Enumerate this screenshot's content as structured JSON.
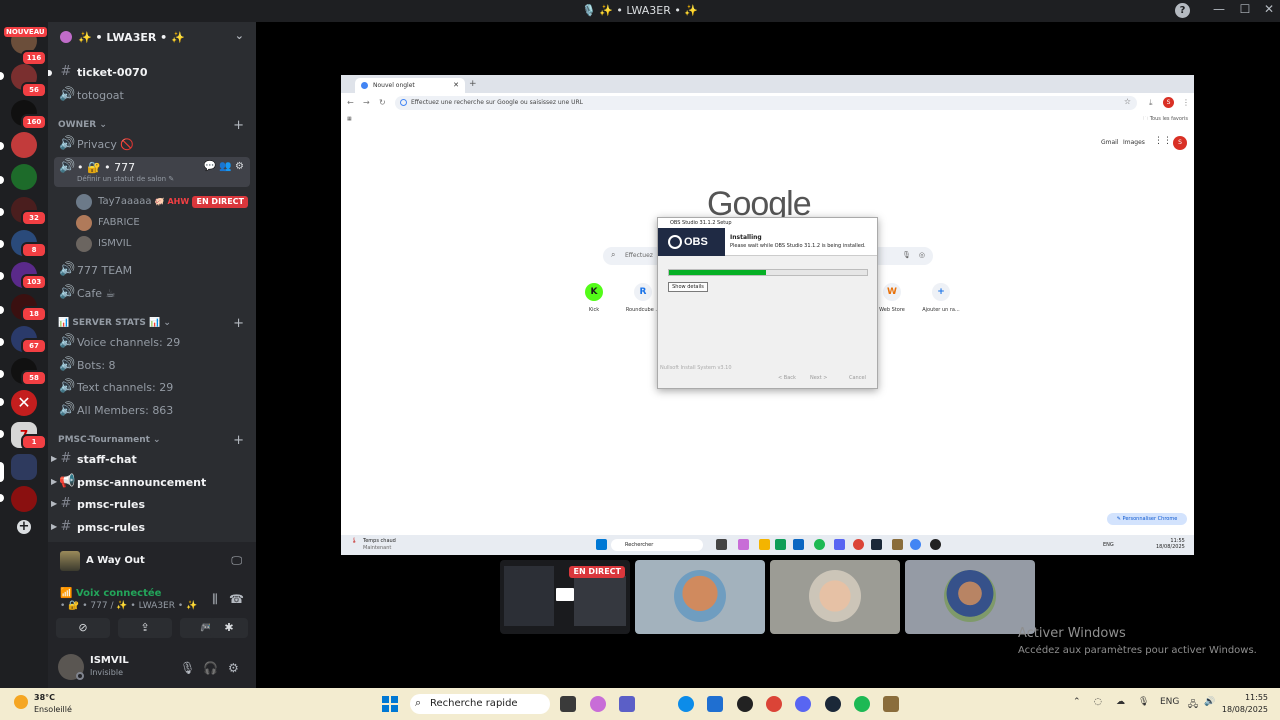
{
  "window": {
    "title": "🎙️ ✨ • LWA3ER • ✨",
    "help": "?",
    "controls": {
      "minimize": "—",
      "maximize": "☐",
      "close": "✕"
    }
  },
  "rail": {
    "new_badge": "NOUVEAU",
    "add_server": "+",
    "badges": [
      "116",
      "56",
      "160",
      "32",
      "8",
      "103",
      "18",
      "67",
      "58",
      "1"
    ]
  },
  "server": {
    "name": "✨ • LWA3ER • ✨",
    "chevron": "⌄"
  },
  "channels": {
    "ticket": "ticket-0070",
    "totogoat": "totogoat",
    "owner_category": "OWNER",
    "privacy": "Privacy 🚫",
    "voice777": "• 🔐 • 777",
    "voice777_status": "Définir un statut de salon ✎",
    "voice_users": [
      {
        "name": "Tay7aaaaa",
        "tag": "🐖 AHW"
      },
      {
        "name": "FABRICE",
        "tag": ""
      },
      {
        "name": "ISMVIL",
        "tag": ""
      }
    ],
    "live_label": "EN DIRECT",
    "team": "777 TEAM",
    "cafe": "Cafe ☕",
    "stats_category": "📊 SERVER STATS 📊",
    "stat_voice": "Voice channels: 29",
    "stat_bots": "Bots: 8",
    "stat_text": "Text channels: 29",
    "stat_members": "All Members: 863",
    "pmsc_category": "PMSC-Tournament",
    "staff_chat": "staff-chat",
    "pmsc_announcement": "pmsc-announcement",
    "pmsc_rules_1": "pmsc-rules",
    "pmsc_rules_2": "pmsc-rules"
  },
  "voice_panel": {
    "game": "A Way Out",
    "connected": "Voix connectée",
    "location": "• 🔐 • 777 / ✨ • LWA3ER • ✨"
  },
  "user": {
    "name": "ISMVIL",
    "status": "Invisible"
  },
  "stream": {
    "tab_title": "Nouvel onglet",
    "omnibox_placeholder": "Effectuez une recherche sur Google ou saisissez une URL",
    "bookmarks_all": "Tous les favoris",
    "gmail": "Gmail",
    "images": "Images",
    "profile_letter": "S",
    "google_logo": "Google",
    "search_placeholder": "Effectuez",
    "shortcuts": [
      {
        "label": "Kick",
        "glyph": "K"
      },
      {
        "label": "Roundcube ...",
        "glyph": "R"
      },
      {
        "label": "Web Store",
        "glyph": "W"
      },
      {
        "label": "Ajouter un ra...",
        "glyph": "+"
      }
    ],
    "customize": "✎ Personnaliser Chrome",
    "remote_weather": "Temps chaud",
    "remote_weather_sub": "Maintenant",
    "remote_search": "Rechercher",
    "remote_lang": "ENG",
    "remote_time": "11:55",
    "remote_date": "18/08/2025"
  },
  "obs": {
    "window_title": "OBS Studio 31.1.2 Setup",
    "logo": "OBS",
    "heading": "Installing",
    "subtext": "Please wait while OBS Studio 31.1.2 is being installed.",
    "progress": 0.49,
    "show_details": "Show details",
    "footer": "Nullsoft Install System v3.10",
    "back": "< Back",
    "next": "Next >",
    "cancel": "Cancel"
  },
  "tiles": {
    "live_label": "EN DIRECT"
  },
  "activation": {
    "title": "Activer Windows",
    "subtitle": "Accédez aux paramètres pour activer Windows."
  },
  "taskbar": {
    "temperature": "38°C",
    "condition": "Ensoleillé",
    "search": "Recherche rapide",
    "lang": "ENG",
    "time": "11:55",
    "date": "18/08/2025"
  }
}
